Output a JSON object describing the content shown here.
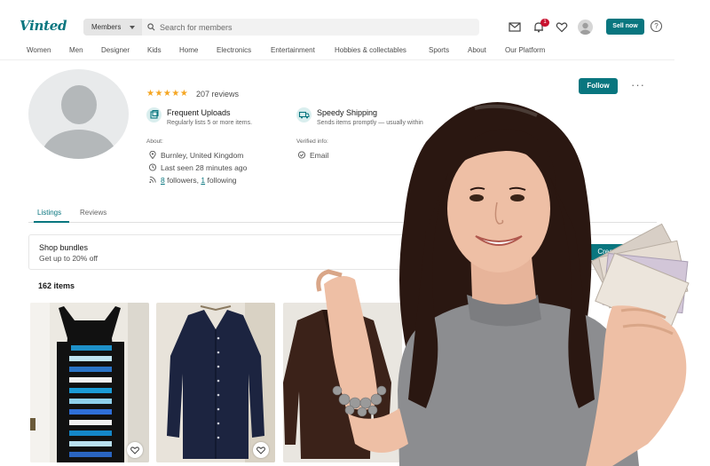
{
  "header": {
    "logo": "Vinted",
    "search_scope": "Members",
    "search_placeholder": "Search for members",
    "notification_count": "1",
    "sell_label": "Sell now",
    "help_glyph": "?"
  },
  "categories": [
    "Women",
    "Men",
    "Designer",
    "Kids",
    "Home",
    "Electronics",
    "Entertainment",
    "Hobbies & collectables",
    "Sports",
    "About",
    "Our Platform"
  ],
  "profile": {
    "stars": "★★★★★",
    "reviews": "207 reviews",
    "badges": [
      {
        "title": "Frequent Uploads",
        "subtitle": "Regularly lists 5 or more items."
      },
      {
        "title": "Speedy Shipping",
        "subtitle": "Sends items promptly — usually within"
      }
    ],
    "about_heading": "About:",
    "location": "Burnley, United Kingdom",
    "last_seen": "Last seen 28 minutes ago",
    "followers_count": "8",
    "followers_text": " followers, ",
    "following_count": "1",
    "following_text": " following",
    "verified_heading": "Verified info:",
    "verified_email": "Email",
    "follow_label": "Follow",
    "more_label": "···"
  },
  "tabs": [
    {
      "label": "Listings",
      "active": true
    },
    {
      "label": "Reviews",
      "active": false
    }
  ],
  "bundles": {
    "title": "Shop bundles",
    "subtitle": "Get up to 20% off",
    "button_label": "Crea"
  },
  "items_count": "162 items",
  "listings": [
    {
      "item": "striped-dress"
    },
    {
      "item": "navy-cardigan"
    },
    {
      "item": "brown-jacket"
    }
  ],
  "colors": {
    "brand": "#09767f",
    "star": "#f5a623",
    "badge": "#c8102e"
  },
  "icons": [
    "search-icon",
    "mail-icon",
    "bell-icon",
    "heart-icon",
    "help-icon",
    "location-icon",
    "clock-icon",
    "rss-icon",
    "check-circle-icon",
    "frequent-uploads-icon",
    "speedy-shipping-icon"
  ]
}
